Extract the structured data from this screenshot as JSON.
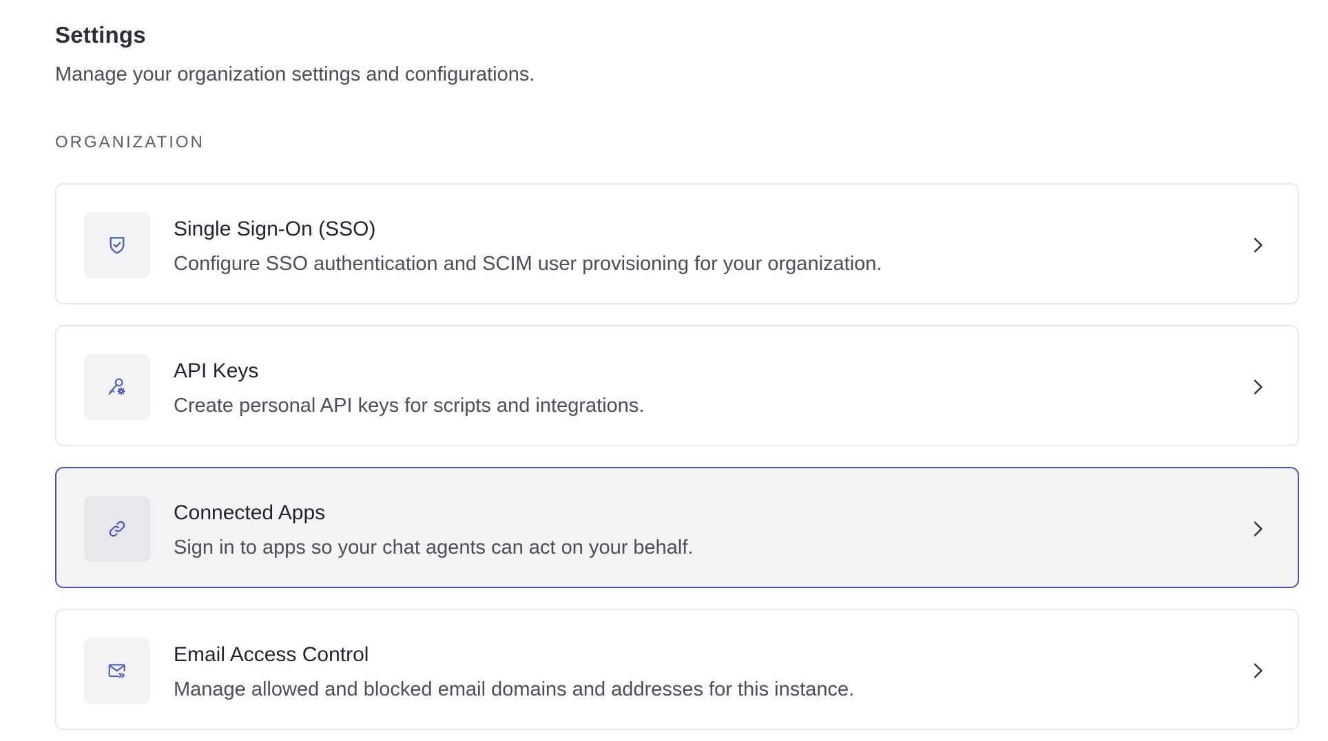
{
  "header": {
    "title": "Settings",
    "subtitle": "Manage your organization settings and configurations."
  },
  "section": {
    "label": "ORGANIZATION"
  },
  "items": [
    {
      "title": "Single Sign-On (SSO)",
      "description": "Configure SSO authentication and SCIM user provisioning for your organization.",
      "icon": "shield-check-icon",
      "selected": false
    },
    {
      "title": "API Keys",
      "description": "Create personal API keys for scripts and integrations.",
      "icon": "key-icon",
      "selected": false
    },
    {
      "title": "Connected Apps",
      "description": "Sign in to apps so your chat agents can act on your behalf.",
      "icon": "link-icon",
      "selected": true
    },
    {
      "title": "Email Access Control",
      "description": "Manage allowed and blocked email domains and addresses for this instance.",
      "icon": "mail-forward-icon",
      "selected": false
    }
  ],
  "colors": {
    "accent": "#4353d4",
    "icon": "#4353d4",
    "border": "#e8e9ec",
    "selected_background": "#f4f4f5"
  }
}
